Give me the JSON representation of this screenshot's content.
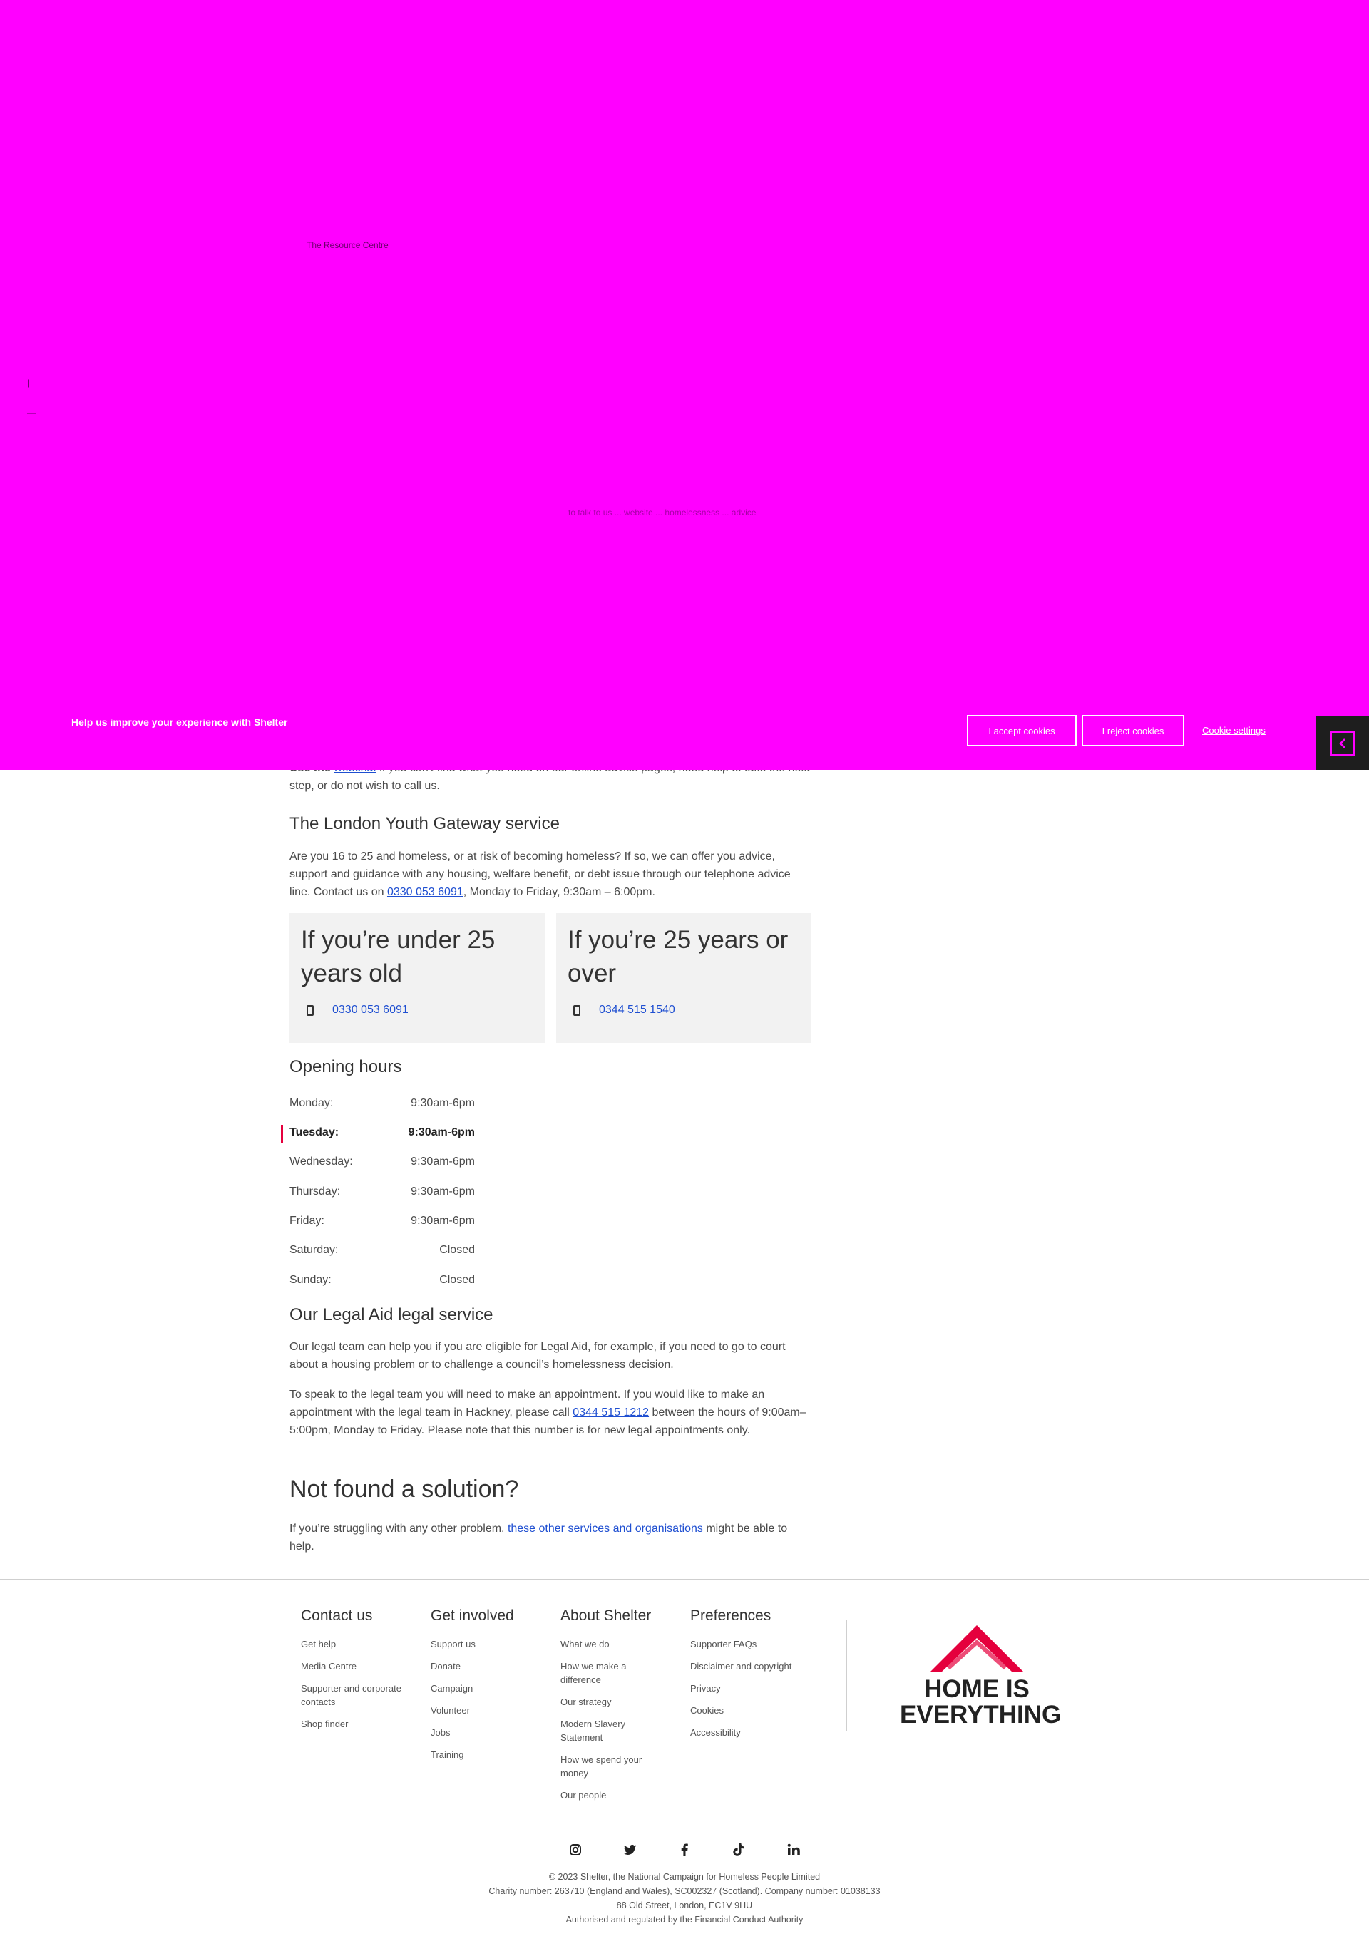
{
  "overlay": {
    "breadcrumb_fragment": "The Resource Centre",
    "faint_line": "to talk to us ... website ... homelessness ... advice"
  },
  "cookie_banner": {
    "message": "Help us improve your experience with Shelter",
    "accept_label": "I accept cookies",
    "reject_label": "I reject cookies",
    "settings_label": "Cookie settings"
  },
  "webchat": {
    "prefix": "Use the",
    "link": "webchat",
    "rest": " if you can't find what you need on our online advice pages, need help to take the next step, or do not wish to call us."
  },
  "youth": {
    "heading": "The London Youth Gateway service",
    "body_before": "Are you 16 to 25 and homeless, or at risk of becoming homeless? If so, we can offer you advice, support and guidance with any housing, welfare benefit, or debt issue through our telephone advice line. Contact us on ",
    "phone_link": "0330 053 6091",
    "body_after": ", Monday to Friday, 9:30am – 6:00pm."
  },
  "cards": [
    {
      "title": "If you’re under 25 years old",
      "phone": "0330 053 6091"
    },
    {
      "title": "If you’re 25 years or over",
      "phone": "0344 515 1540"
    }
  ],
  "opening_hours": {
    "heading": "Opening hours",
    "rows": [
      {
        "day": "Monday:",
        "time": "9:30am-6pm"
      },
      {
        "day": "Tuesday:",
        "time": "9:30am-6pm"
      },
      {
        "day": "Wednesday:",
        "time": "9:30am-6pm"
      },
      {
        "day": "Thursday:",
        "time": "9:30am-6pm"
      },
      {
        "day": "Friday:",
        "time": "9:30am-6pm"
      },
      {
        "day": "Saturday:",
        "time": "Closed"
      },
      {
        "day": "Sunday:",
        "time": "Closed"
      }
    ],
    "today_index": 1
  },
  "legal_aid": {
    "heading": "Our Legal Aid legal service",
    "p1": "Our legal team can help you if you are eligible for Legal Aid, for example, if you need to go to court about a housing problem or to challenge a council’s homelessness decision.",
    "p2_before": "To speak to the legal team you will need to make an appointment. If you would like to make an appointment with the legal team in Hackney, please call ",
    "p2_link": "0344 515 1212",
    "p2_after": " between the hours of 9:00am–5:00pm, Monday to Friday. Please note that this number is for new legal appointments only."
  },
  "not_found": {
    "heading": "Not found a solution?",
    "before": "If you’re struggling with any other problem, ",
    "link": "these other services and organisations",
    "after": " might be able to help."
  },
  "footer": {
    "columns": [
      {
        "heading": "Contact us",
        "links": [
          "Get help",
          "Media Centre",
          "Supporter and corporate contacts",
          "Shop finder"
        ]
      },
      {
        "heading": "Get involved",
        "links": [
          "Support us",
          "Donate",
          "Campaign",
          "Volunteer",
          "Jobs",
          "Training"
        ]
      },
      {
        "heading": "About Shelter",
        "links": [
          "What we do",
          "How we make a difference",
          "Our strategy",
          "Modern Slavery Statement",
          "How we spend your money",
          "Our people"
        ]
      },
      {
        "heading": "Preferences",
        "links": [
          "Supporter FAQs",
          "Disclaimer and copyright",
          "Privacy",
          "Cookies",
          "Accessibility"
        ]
      }
    ],
    "logo_line1": "HOME IS",
    "logo_line2": "EVERYTHING",
    "social_icons": [
      "instagram-icon",
      "twitter-icon",
      "facebook-icon",
      "tiktok-icon",
      "linkedin-icon"
    ],
    "legal_lines": [
      "© 2023 Shelter, the National Campaign for Homeless People Limited",
      "Charity number: 263710 (England and Wales), SC002327 (Scotland). Company number: 01038133",
      "88 Old Street, London, EC1V 9HU",
      "Authorised and regulated by the Financial Conduct Authority"
    ]
  },
  "colors": {
    "overlay": "#ff00ff",
    "accent_red": "#e5003d",
    "link": "#1f4fd1",
    "card_bg": "#f2f2f2"
  }
}
